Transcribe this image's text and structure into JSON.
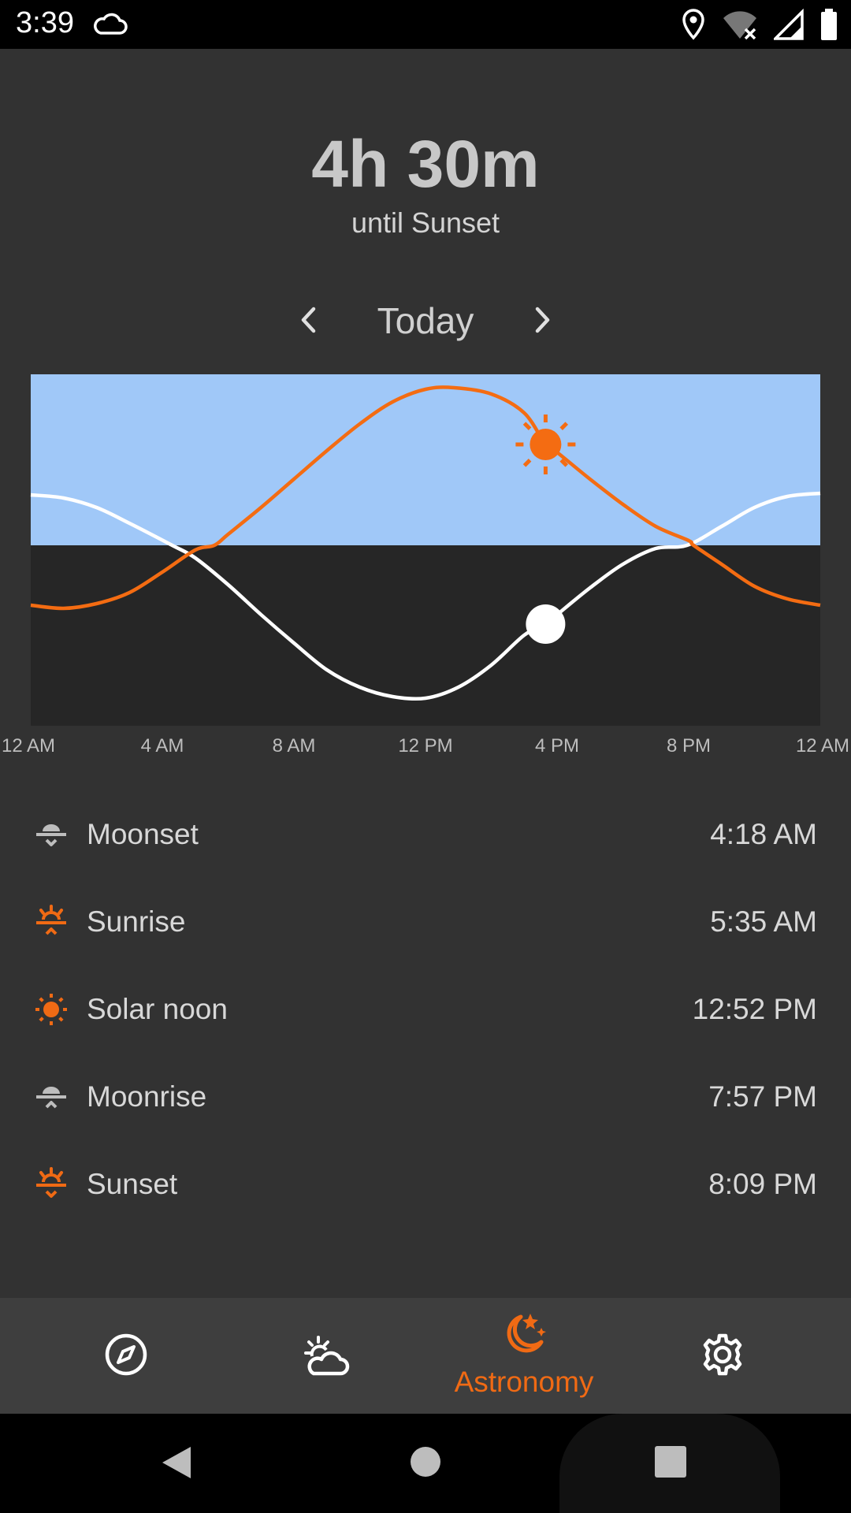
{
  "status": {
    "time": "3:39",
    "icons": [
      "cloud-icon",
      "location-icon",
      "wifi-off-icon",
      "signal-icon",
      "battery-icon"
    ]
  },
  "countdown": {
    "value": "4h 30m",
    "label": "until Sunset"
  },
  "day_nav": {
    "label": "Today",
    "prev_icon": "chevron-left-icon",
    "next_icon": "chevron-right-icon"
  },
  "chart_data": {
    "type": "line",
    "x_ticks": [
      "12 AM",
      "4 AM",
      "8 AM",
      "12 PM",
      "4 PM",
      "8 PM",
      "12 AM"
    ],
    "x_range_hours": [
      0,
      24
    ],
    "horizon_altitude": 0,
    "series": [
      {
        "color": "#f46c12",
        "x_hours": [
          0,
          1,
          2,
          3,
          4,
          5,
          5.58,
          6,
          7,
          8,
          9,
          10,
          11,
          12,
          12.87,
          14,
          15,
          15.65,
          16,
          17,
          18,
          19,
          20,
          20.15,
          21,
          22,
          23,
          24
        ],
        "altitude": [
          -0.38,
          -0.4,
          -0.37,
          -0.3,
          -0.17,
          -0.03,
          0,
          0.07,
          0.24,
          0.42,
          0.6,
          0.77,
          0.91,
          0.99,
          1.0,
          0.96,
          0.84,
          0.64,
          0.59,
          0.42,
          0.26,
          0.12,
          0.03,
          0,
          -0.12,
          -0.26,
          -0.34,
          -0.38
        ]
      },
      {
        "color": "#ffffff",
        "x_hours": [
          0,
          1,
          2,
          3,
          4.3,
          5,
          6,
          7,
          8,
          9,
          10,
          11,
          12,
          13,
          14,
          15,
          15.65,
          16,
          17,
          18,
          19,
          19.95,
          21,
          22,
          23,
          24
        ],
        "altitude": [
          0.32,
          0.3,
          0.24,
          0.14,
          0,
          -0.08,
          -0.25,
          -0.44,
          -0.62,
          -0.79,
          -0.9,
          -0.96,
          -0.97,
          -0.9,
          -0.76,
          -0.57,
          -0.5,
          -0.44,
          -0.27,
          -0.12,
          -0.02,
          0,
          0.12,
          0.24,
          0.31,
          0.33
        ]
      }
    ],
    "markers": [
      {
        "series": 0,
        "x_hours": 15.65,
        "icon": "sun-icon"
      },
      {
        "series": 1,
        "x_hours": 15.65,
        "icon": "moon-dot"
      }
    ],
    "sky_color": "#a0c8f8",
    "ground_color": "#262626"
  },
  "events": [
    {
      "name": "Moonset",
      "time": "4:18 AM",
      "icon": "moonset-icon",
      "color": "#bdbdbd"
    },
    {
      "name": "Sunrise",
      "time": "5:35 AM",
      "icon": "sunrise-icon",
      "color": "#f06a14"
    },
    {
      "name": "Solar noon",
      "time": "12:52 PM",
      "icon": "sun-icon",
      "color": "#f06a14"
    },
    {
      "name": "Moonrise",
      "time": "7:57 PM",
      "icon": "moonrise-icon",
      "color": "#bdbdbd"
    },
    {
      "name": "Sunset",
      "time": "8:09 PM",
      "icon": "sunset-icon",
      "color": "#f06a14"
    }
  ],
  "bottom_nav": {
    "items": [
      {
        "name": "compass-icon"
      },
      {
        "name": "weather-icon"
      },
      {
        "name": "astronomy-icon",
        "label": "Astronomy",
        "active": true
      },
      {
        "name": "gear-icon"
      }
    ],
    "accent": "#f06a14"
  }
}
